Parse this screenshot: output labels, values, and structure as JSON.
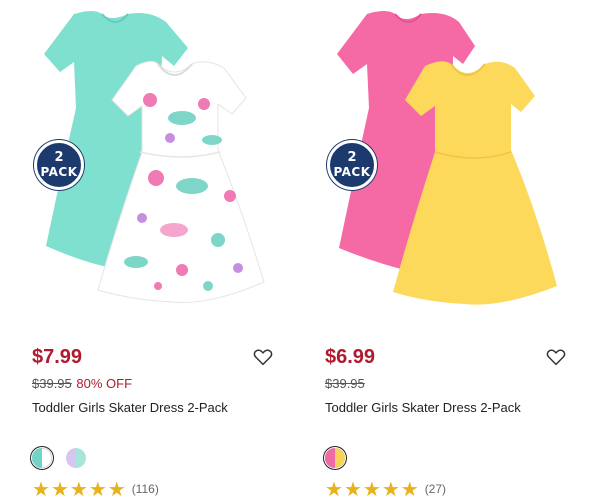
{
  "products": [
    {
      "badge": {
        "num": "2",
        "word": "PACK"
      },
      "price": "$7.99",
      "original_price": "$39.95",
      "discount": "80% OFF",
      "title": "Toddler Girls Skater Dress 2-Pack",
      "swatches": [
        {
          "left": "#6fd6c7",
          "right": "#ffffff",
          "selected": true
        },
        {
          "left": "#d9c6ee",
          "right": "#a6e6da",
          "selected": false
        }
      ],
      "rating": {
        "stars": 5,
        "count": "(116)"
      },
      "colors": {
        "back_dress": "#7fe0d0",
        "front_dress": "#ffffff",
        "print_pink": "#f07ab4",
        "print_teal": "#7ed6c8"
      }
    },
    {
      "badge": {
        "num": "2",
        "word": "PACK"
      },
      "price": "$6.99",
      "original_price": "$39.95",
      "discount": "",
      "title": "Toddler Girls Skater Dress 2-Pack",
      "swatches": [
        {
          "left": "#f06aa6",
          "right": "#f7d35c",
          "selected": true
        }
      ],
      "rating": {
        "stars": 5,
        "count": "(27)"
      },
      "colors": {
        "back_dress": "#f56aa5",
        "front_dress": "#fcd95a"
      }
    }
  ],
  "icons": {
    "wishlist": "heart-outline-icon",
    "star": "star-icon"
  },
  "colors": {
    "price": "#b01a2e",
    "badge": "#1d3a6e",
    "star": "#e7b21c"
  }
}
